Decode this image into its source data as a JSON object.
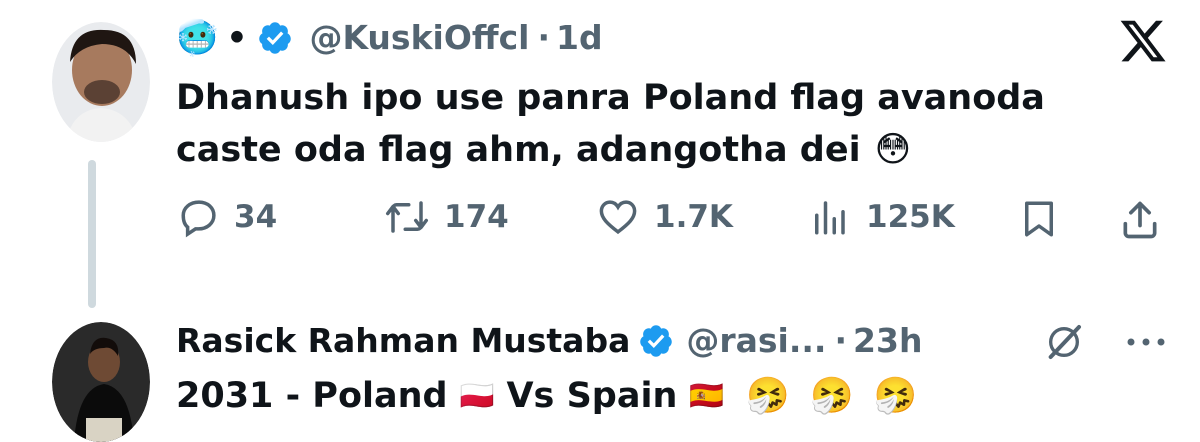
{
  "tweet1": {
    "emoji": "🥶",
    "separator": "•",
    "handle": "@KuskiOffcl",
    "time_sep": "·",
    "time": "1d",
    "text_line1": "Dhanush ipo use panra Poland flag avanoda",
    "text_line2": "caste oda flag ahm, adangotha dei",
    "text_emoji": "😳",
    "actions": {
      "replies": "34",
      "reposts": "174",
      "likes": "1.7K",
      "views": "125K"
    }
  },
  "tweet2": {
    "name": "Rasick Rahman Mustaba",
    "handle": "@rasi...",
    "time_sep": "·",
    "time": "23h",
    "text_part1": "2031 - Poland",
    "flag1": "🇵🇱",
    "text_part2": "Vs Spain",
    "flag2": "🇪🇸",
    "emoji_sequence": "🤧 🤧 🤧"
  },
  "icons": {
    "close": "x-logo-icon",
    "grok": "grok-icon",
    "more": "more-icon"
  },
  "colors": {
    "verified_blue": "#1d9bf0",
    "muted": "#536471",
    "text": "#0f1419",
    "thread_line": "#cfd9de"
  }
}
